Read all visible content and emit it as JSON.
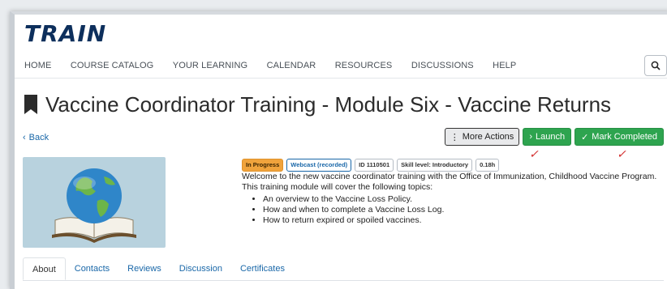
{
  "brand": {
    "logo_text": "TRAIN",
    "logo_color": "#0d2f5c",
    "accent": "#f0a33c"
  },
  "nav": {
    "items": [
      "HOME",
      "COURSE CATALOG",
      "YOUR LEARNING",
      "CALENDAR",
      "RESOURCES",
      "DISCUSSIONS",
      "HELP"
    ],
    "search_icon": "search-icon"
  },
  "page": {
    "title": "Vaccine Coordinator Training - Module Six - Vaccine Returns",
    "title_icon": "bookmark-icon",
    "back_label": "Back"
  },
  "actions": {
    "more_label": "More Actions",
    "launch_label": "Launch",
    "complete_label": "Mark Completed",
    "green": "#2ea44f"
  },
  "badges": {
    "status": "In Progress",
    "format": "Webcast (recorded)",
    "id": "ID 1110501",
    "skill": "Skill level: Introductory",
    "hours": "0.18h"
  },
  "description": {
    "intro": "Welcome to the new vaccine coordinator training with the Office of Immunization, Childhood Vaccine Program. This training module will cover the following topics:",
    "topics": [
      "An overview to the Vaccine Loss Policy.",
      "How and when to complete a Vaccine Loss Log.",
      "How to return expired or spoiled vaccines."
    ]
  },
  "tabs": [
    "About",
    "Contacts",
    "Reviews",
    "Discussion",
    "Certificates"
  ],
  "active_tab": "About"
}
